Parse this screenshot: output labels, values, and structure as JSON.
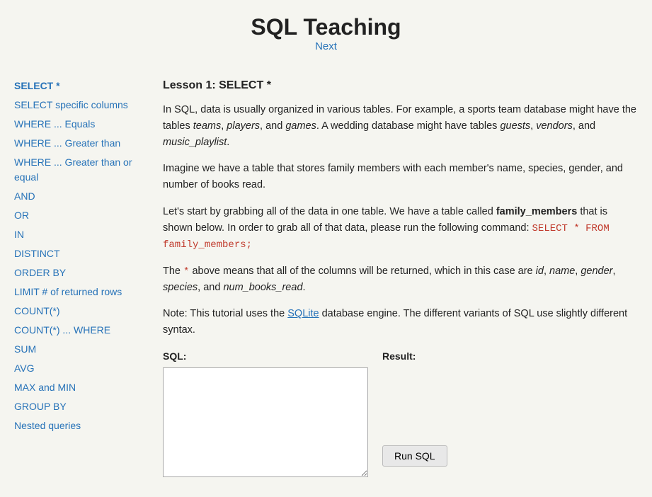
{
  "header": {
    "title": "SQL Teaching",
    "next_label": "Next"
  },
  "sidebar": {
    "items": [
      {
        "label": "SELECT *",
        "active": true
      },
      {
        "label": "SELECT specific columns",
        "active": false
      },
      {
        "label": "WHERE ... Equals",
        "active": false
      },
      {
        "label": "WHERE ... Greater than",
        "active": false
      },
      {
        "label": "WHERE ... Greater than or equal",
        "active": false
      },
      {
        "label": "AND",
        "active": false
      },
      {
        "label": "OR",
        "active": false
      },
      {
        "label": "IN",
        "active": false
      },
      {
        "label": "DISTINCT",
        "active": false
      },
      {
        "label": "ORDER BY",
        "active": false
      },
      {
        "label": "LIMIT # of returned rows",
        "active": false
      },
      {
        "label": "COUNT(*)",
        "active": false
      },
      {
        "label": "COUNT(*) ... WHERE",
        "active": false
      },
      {
        "label": "SUM",
        "active": false
      },
      {
        "label": "AVG",
        "active": false
      },
      {
        "label": "MAX and MIN",
        "active": false
      },
      {
        "label": "GROUP BY",
        "active": false
      },
      {
        "label": "Nested queries",
        "active": false
      }
    ]
  },
  "content": {
    "lesson_title": "Lesson 1: SELECT *",
    "paragraph1": "In SQL, data is usually organized in various tables. For example, a sports team database might have the tables teams, players, and games. A wedding database might have tables guests, vendors, and music_playlist.",
    "paragraph1_italics": [
      "teams",
      "players",
      "games",
      "guests",
      "vendors",
      "music_playlist"
    ],
    "paragraph2": "Imagine we have a table that stores family members with each member’s name, species, gender, and number of books read.",
    "paragraph3_start": "Let’s start by grabbing all of the data in one table. We have a table called ",
    "paragraph3_bold": "family_members",
    "paragraph3_middle": " that is shown below. In order to grab all of that data, please run the following command: ",
    "paragraph3_code": "SELECT * FROM family_members;",
    "paragraph4_start": "The ",
    "paragraph4_code": "*",
    "paragraph4_end": " above means that all of the columns will be returned, which in this case are id, name, gender, species, and num_books_read.",
    "paragraph4_italics": [
      "id",
      "name",
      "gender",
      "species",
      "num_books_read"
    ],
    "paragraph5": "Note: This tutorial uses the SQLite database engine. The different variants of SQL use slightly different syntax.",
    "paragraph5_link": "SQLite",
    "sql_label": "SQL:",
    "result_label": "Result:",
    "run_sql_button": "Run SQL",
    "sql_textarea_value": ""
  }
}
